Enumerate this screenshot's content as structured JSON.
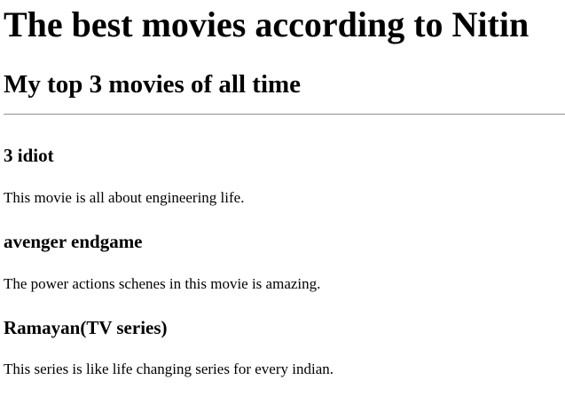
{
  "page": {
    "title": "The best movies according to Nitin",
    "subtitle": "My top 3 movies of all time"
  },
  "movies": [
    {
      "name": "3 idiot",
      "description": "This movie is all about engineering life."
    },
    {
      "name": "avenger endgame",
      "description": "The power actions schenes in this movie is amazing."
    },
    {
      "name": "Ramayan(TV series)",
      "description": "This series is like life changing series for every indian."
    }
  ]
}
